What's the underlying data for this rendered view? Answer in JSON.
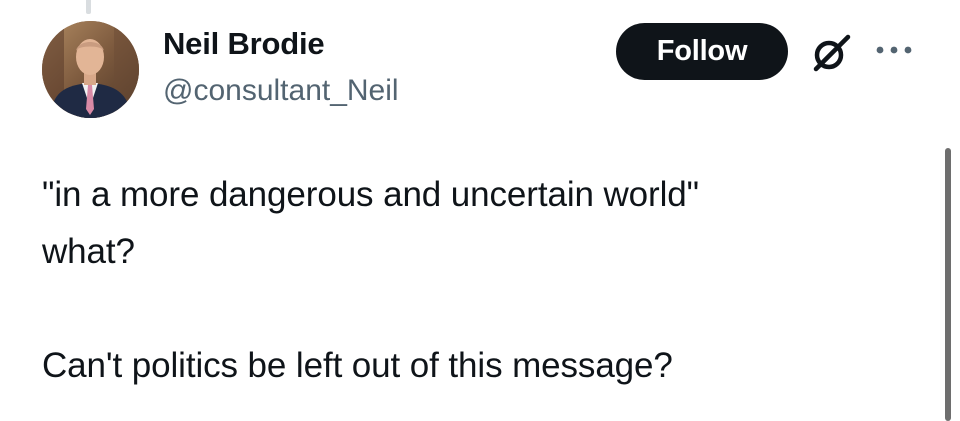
{
  "author": {
    "display_name": "Neil Brodie",
    "handle": "@consultant_Neil"
  },
  "header_actions": {
    "follow_label": "Follow",
    "grok_icon": "grok-icon",
    "more_icon": "more-options-icon"
  },
  "tweet": {
    "lines": [
      "\"in a more dangerous and uncertain world\"",
      "what?",
      "",
      "Can't politics be left out of this message?"
    ]
  },
  "colors": {
    "text_primary": "#0f1419",
    "text_secondary": "#536471",
    "button_bg": "#0f1419",
    "button_text": "#ffffff"
  }
}
